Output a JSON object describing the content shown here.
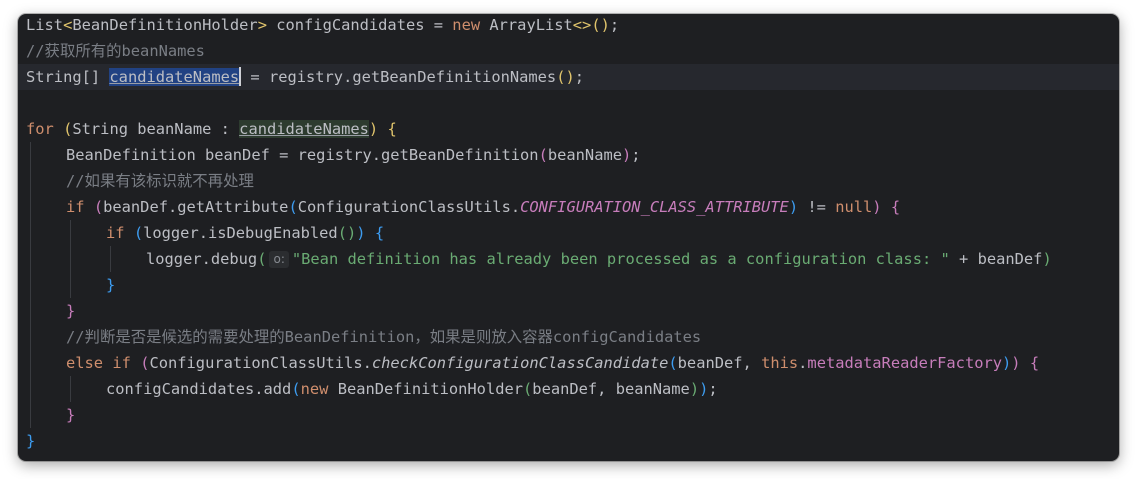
{
  "editor": {
    "lines": [
      {
        "id": 1,
        "indent": 0,
        "tokens": [
          {
            "t": "List",
            "c": ""
          },
          {
            "t": "<",
            "c": "b1"
          },
          {
            "t": "BeanDefinitionHolder",
            "c": ""
          },
          {
            "t": ">",
            "c": "b1"
          },
          {
            "t": " configCandidates = ",
            "c": ""
          },
          {
            "t": "new",
            "c": "kw"
          },
          {
            "t": " ArrayList",
            "c": ""
          },
          {
            "t": "<>",
            "c": "b1"
          },
          {
            "t": "()",
            "c": "b1"
          },
          {
            "t": ";",
            "c": ""
          }
        ]
      },
      {
        "id": 2,
        "indent": 0,
        "tokens": [
          {
            "t": "//",
            "c": "cm"
          },
          {
            "t": "获取所有的",
            "c": "cm cjk"
          },
          {
            "t": "beanNames",
            "c": "cm"
          }
        ]
      },
      {
        "id": 3,
        "indent": 0,
        "current": true,
        "tokens": [
          {
            "t": "String[] ",
            "c": ""
          },
          {
            "t": "candidateNames",
            "c": "sel",
            "name": "selected-identifier"
          },
          {
            "t": "",
            "c": "caret",
            "name": "text-caret"
          },
          {
            "t": " = registry.getBeanDefinitionNames",
            "c": ""
          },
          {
            "t": "()",
            "c": "b1"
          },
          {
            "t": ";",
            "c": ""
          }
        ]
      },
      {
        "id": 4,
        "indent": 0,
        "tokens": []
      },
      {
        "id": 5,
        "indent": 0,
        "tokens": [
          {
            "t": "for",
            "c": "kw"
          },
          {
            "t": " ",
            "c": ""
          },
          {
            "t": "(",
            "c": "b1"
          },
          {
            "t": "String beanName : ",
            "c": ""
          },
          {
            "t": "candidateNames",
            "c": "hl",
            "name": "highlighted-usage"
          },
          {
            "t": ")",
            "c": "b1"
          },
          {
            "t": " ",
            "c": ""
          },
          {
            "t": "{",
            "c": "b1"
          }
        ]
      },
      {
        "id": 6,
        "indent": 1,
        "tokens": [
          {
            "t": "BeanDefinition beanDef = registry.getBeanDefinition",
            "c": ""
          },
          {
            "t": "(",
            "c": "b2"
          },
          {
            "t": "beanName",
            "c": ""
          },
          {
            "t": ")",
            "c": "b2"
          },
          {
            "t": ";",
            "c": ""
          }
        ]
      },
      {
        "id": 7,
        "indent": 1,
        "tokens": [
          {
            "t": "//",
            "c": "cm"
          },
          {
            "t": "如果有该标识就不再处理",
            "c": "cm cjk"
          }
        ]
      },
      {
        "id": 8,
        "indent": 1,
        "tokens": [
          {
            "t": "if",
            "c": "kw"
          },
          {
            "t": " ",
            "c": ""
          },
          {
            "t": "(",
            "c": "b2"
          },
          {
            "t": "beanDef.getAttribute",
            "c": ""
          },
          {
            "t": "(",
            "c": "b3"
          },
          {
            "t": "ConfigurationClassUtils.",
            "c": ""
          },
          {
            "t": "CONFIGURATION_CLASS_ATTRIBUTE",
            "c": "cst"
          },
          {
            "t": ")",
            "c": "b3"
          },
          {
            "t": " != ",
            "c": ""
          },
          {
            "t": "null",
            "c": "kw"
          },
          {
            "t": ")",
            "c": "b2"
          },
          {
            "t": " ",
            "c": ""
          },
          {
            "t": "{",
            "c": "b2"
          }
        ]
      },
      {
        "id": 9,
        "indent": 2,
        "tokens": [
          {
            "t": "if",
            "c": "kw"
          },
          {
            "t": " ",
            "c": ""
          },
          {
            "t": "(",
            "c": "b3"
          },
          {
            "t": "logger.isDebugEnabled",
            "c": ""
          },
          {
            "t": "()",
            "c": "b4"
          },
          {
            "t": ")",
            "c": "b3"
          },
          {
            "t": " ",
            "c": ""
          },
          {
            "t": "{",
            "c": "b3"
          }
        ]
      },
      {
        "id": 10,
        "indent": 3,
        "tokens": [
          {
            "t": "logger.debug",
            "c": ""
          },
          {
            "t": "(",
            "c": "b4"
          },
          {
            "t": "o:",
            "c": "hint",
            "name": "parameter-hint"
          },
          {
            "t": "\"Bean definition has already been processed as a configuration class: \"",
            "c": "str"
          },
          {
            "t": " + beanDef",
            "c": ""
          },
          {
            "t": ")",
            "c": "b4"
          }
        ]
      },
      {
        "id": 11,
        "indent": 2,
        "tokens": [
          {
            "t": "}",
            "c": "b3"
          }
        ]
      },
      {
        "id": 12,
        "indent": 1,
        "tokens": [
          {
            "t": "}",
            "c": "b2"
          }
        ]
      },
      {
        "id": 13,
        "indent": 1,
        "tokens": [
          {
            "t": "//",
            "c": "cm"
          },
          {
            "t": "判断是否是候选的需要处理的",
            "c": "cm cjk"
          },
          {
            "t": "BeanDefinition",
            "c": "cm"
          },
          {
            "t": "，如果是则放入容器",
            "c": "cm cjk"
          },
          {
            "t": "configCandidates",
            "c": "cm"
          }
        ]
      },
      {
        "id": 14,
        "indent": 1,
        "tokens": [
          {
            "t": "else",
            "c": "kw"
          },
          {
            "t": " ",
            "c": ""
          },
          {
            "t": "if",
            "c": "kw"
          },
          {
            "t": " ",
            "c": ""
          },
          {
            "t": "(",
            "c": "b2"
          },
          {
            "t": "ConfigurationClassUtils.",
            "c": ""
          },
          {
            "t": "checkConfigurationClassCandidate",
            "c": "it"
          },
          {
            "t": "(",
            "c": "b3"
          },
          {
            "t": "beanDef, ",
            "c": ""
          },
          {
            "t": "this",
            "c": "kw"
          },
          {
            "t": ".",
            "c": ""
          },
          {
            "t": "metadataReaderFactory",
            "c": "fld"
          },
          {
            "t": ")",
            "c": "b3"
          },
          {
            "t": ")",
            "c": "b2"
          },
          {
            "t": " ",
            "c": ""
          },
          {
            "t": "{",
            "c": "b2"
          }
        ]
      },
      {
        "id": 15,
        "indent": 2,
        "tokens": [
          {
            "t": "configCandidates.add",
            "c": ""
          },
          {
            "t": "(",
            "c": "b3"
          },
          {
            "t": "new",
            "c": "kw"
          },
          {
            "t": " BeanDefinitionHolder",
            "c": ""
          },
          {
            "t": "(",
            "c": "b4"
          },
          {
            "t": "beanDef, beanName",
            "c": ""
          },
          {
            "t": ")",
            "c": "b4"
          },
          {
            "t": ")",
            "c": "b3"
          },
          {
            "t": ";",
            "c": ""
          }
        ]
      },
      {
        "id": 16,
        "indent": 1,
        "tokens": [
          {
            "t": "}",
            "c": "b2"
          }
        ]
      },
      {
        "id": 17,
        "indent": 0,
        "tokens": [
          {
            "t": "}",
            "c": "b3"
          }
        ]
      }
    ],
    "guides": [
      {
        "level": 1,
        "from_line": 6,
        "to_line": 16,
        "color": "#393b40"
      },
      {
        "level": 2,
        "from_line": 9,
        "to_line": 11,
        "color": "#393b40"
      },
      {
        "level": 2,
        "from_line": 15,
        "to_line": 15,
        "color": "#393b40"
      },
      {
        "level": 3,
        "from_line": 10,
        "to_line": 10,
        "color": "#393b40"
      }
    ]
  }
}
